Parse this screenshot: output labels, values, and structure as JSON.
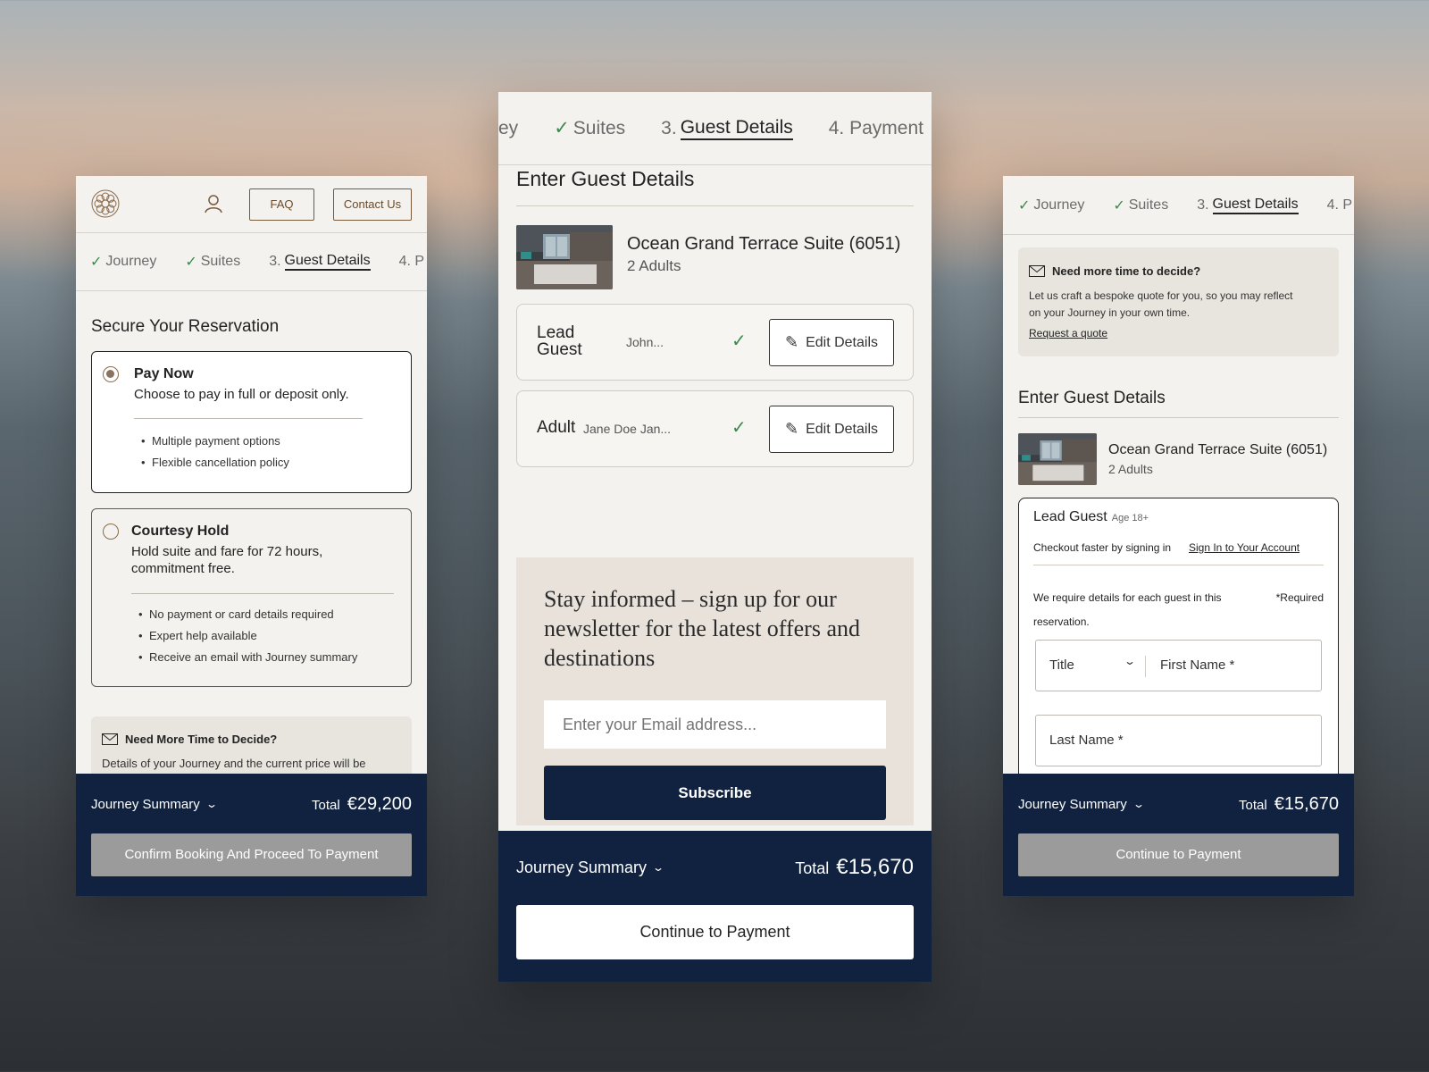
{
  "left_panel": {
    "header": {
      "faq_label": "FAQ",
      "contact_label": "Contact Us"
    },
    "steps": {
      "journey": "Journey",
      "suites": "Suites",
      "guest_num": "3.",
      "guest": "Guest Details",
      "next": "4. P"
    },
    "section_title": "Secure Your Reservation",
    "pay_now": {
      "title": "Pay Now",
      "desc": "Choose to pay in full or deposit only.",
      "bullets": [
        "Multiple payment options",
        "Flexible cancellation policy"
      ]
    },
    "courtesy_hold": {
      "title": "Courtesy Hold",
      "desc_line1": "Hold suite and fare for 72 hours,",
      "desc_line2": "commitment free.",
      "bullets": [
        "No payment or card details required",
        "Expert help available",
        "Receive an email with Journey summary"
      ]
    },
    "note": {
      "title": "Need More Time to Decide?",
      "text": "Details of your Journey and the current price will be"
    },
    "footer": {
      "summary_label": "Journey Summary",
      "total_label": "Total",
      "total_value": "€29,200",
      "cta": "Confirm Booking And Proceed To Payment"
    }
  },
  "center_panel": {
    "steps": {
      "journey_partial": "ey",
      "suites": "Suites",
      "guest_num": "3.",
      "guest": "Guest Details",
      "payment": "4. Payment"
    },
    "section_title": "Enter Guest Details",
    "suite": {
      "name": "Ocean Grand Terrace Suite (6051)",
      "guests": "2 Adults"
    },
    "guests": [
      {
        "label_line1": "Lead",
        "label_line2": "Guest",
        "name": "John...",
        "edit": "Edit Details"
      },
      {
        "label": "Adult",
        "name": "Jane Doe Jan...",
        "edit": "Edit Details"
      }
    ],
    "newsletter": {
      "heading_line1": "Stay informed – sign up for our",
      "heading_line2": "newsletter for the latest offers and",
      "heading_line3": "destinations",
      "email_placeholder": "Enter your Email address...",
      "subscribe": "Subscribe"
    },
    "footer": {
      "summary_label": "Journey Summary",
      "total_label": "Total",
      "total_value": "€15,670",
      "cta": "Continue to Payment"
    }
  },
  "right_panel": {
    "steps": {
      "journey": "Journey",
      "suites": "Suites",
      "guest_num": "3.",
      "guest": "Guest Details",
      "next": "4. P"
    },
    "quote_note": {
      "title": "Need more time to decide?",
      "text_line1": "Let us craft a bespoke quote for you, so you may reflect",
      "text_line2": "on your Journey in your own time.",
      "link": "Request a quote"
    },
    "section_title": "Enter Guest Details",
    "suite": {
      "name": "Ocean Grand Terrace Suite (6051)",
      "guests": "2 Adults"
    },
    "form": {
      "title": "Lead Guest",
      "age": "Age 18+",
      "signin_text": "Checkout faster by signing in",
      "signin_link": "Sign In to Your Account",
      "require_line1": "We require details for each guest in this",
      "require_line2": "reservation.",
      "required": "*Required",
      "title_field": "Title",
      "first_name": "First Name *",
      "last_name": "Last Name *"
    },
    "footer": {
      "summary_label": "Journey Summary",
      "total_label": "Total",
      "total_value": "€15,670",
      "cta": "Continue to Payment"
    }
  },
  "colors": {
    "navy": "#10223f",
    "check_green": "#3b8a4c",
    "accent_brown": "#7a5a3a",
    "panel_bg": "#f3f2ef",
    "button_gray": "#9b9b9b"
  },
  "icons": [
    "lotus-logo-icon",
    "user-icon",
    "check-icon",
    "mail-icon",
    "pencil-icon",
    "chevron-down-icon"
  ]
}
